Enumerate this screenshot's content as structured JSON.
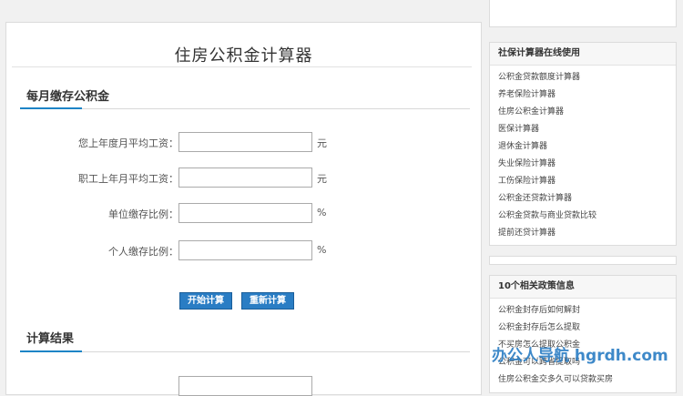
{
  "calculator": {
    "title": "住房公积金计算器",
    "section_monthly": "每月缴存公积金",
    "fields": [
      {
        "label": "您上年度月平均工资：",
        "value": "",
        "unit": "元"
      },
      {
        "label": "职工上年月平均工资：",
        "value": "",
        "unit": "元"
      },
      {
        "label": "单位缴存比例：",
        "value": "",
        "unit": "%"
      },
      {
        "label": "个人缴存比例：",
        "value": "",
        "unit": "%"
      }
    ],
    "start_button": "开始计算",
    "reset_button": "重新计算",
    "section_result": "计算结果"
  },
  "sidebar": {
    "panel1_title": "社保计算器在线使用",
    "panel1_links": [
      "公积金贷款额度计算器",
      "养老保险计算器",
      "住房公积金计算器",
      "医保计算器",
      "退休金计算器",
      "失业保险计算器",
      "工伤保险计算器",
      "公积金还贷款计算器",
      "公积金贷款与商业贷款比较",
      "提前还贷计算器"
    ],
    "panel2_title": "10个相关政策信息",
    "panel2_links": [
      "公积金封存后如何解封",
      "公积金封存后怎么提取",
      "不买房怎么提取公积金",
      "公积金可以跨省提取吗",
      "住房公积金交多久可以贷款买房"
    ]
  },
  "watermark": "办公人导航 hgrdh.com"
}
